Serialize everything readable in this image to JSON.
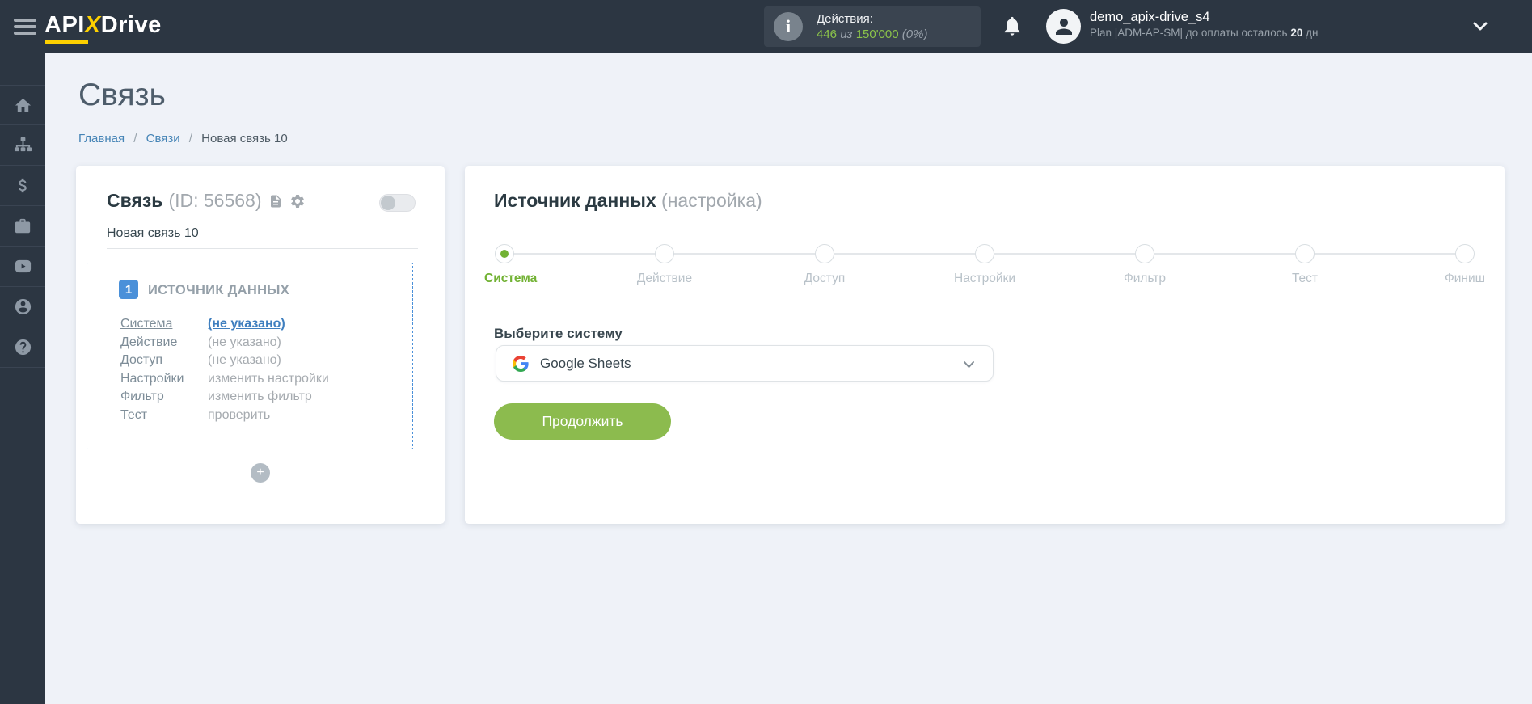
{
  "colors": {
    "navbar_bg": "#2c3642",
    "brand_yellow": "#fdd000",
    "accent_green": "#72b234",
    "button_green": "#8cbb4e",
    "link_blue": "#4584b6",
    "badge_blue": "#4a90d9",
    "page_bg": "#eff2f8"
  },
  "topbar": {
    "logo": {
      "api": "API",
      "x": "X",
      "drive": "Drive"
    },
    "actions": {
      "info_glyph": "i",
      "label": "Действия:",
      "used": "446",
      "of_word": "из",
      "total": "150'000",
      "percent": "(0%)"
    },
    "user": {
      "name": "demo_apix-drive_s4",
      "plan_prefix": "Plan |ADM-AP-SM| до оплаты осталось",
      "days_left": "20",
      "days_suffix": "дн"
    }
  },
  "sidebar": {
    "icons": [
      "home",
      "sitemap",
      "dollar",
      "briefcase",
      "video",
      "user",
      "help"
    ]
  },
  "page": {
    "title": "Связь",
    "breadcrumb": {
      "home": "Главная",
      "links": "Связи",
      "current": "Новая связь 10"
    },
    "breadcrumb_separator": "/"
  },
  "connection_card": {
    "title": "Связь",
    "id_text": "(ID: 56568)",
    "name": "Новая связь 10",
    "source_block": {
      "badge": "1",
      "title": "ИСТОЧНИК ДАННЫХ",
      "rows": [
        {
          "label": "Система",
          "value": "(не указано)"
        },
        {
          "label": "Действие",
          "value": "(не указано)"
        },
        {
          "label": "Доступ",
          "value": "(не указано)"
        },
        {
          "label": "Настройки",
          "value": "изменить настройки"
        },
        {
          "label": "Фильтр",
          "value": "изменить фильтр"
        },
        {
          "label": "Тест",
          "value": "проверить"
        }
      ]
    },
    "add_label": "+"
  },
  "source_card": {
    "title": "Источник данных",
    "subtitle": "(настройка)",
    "steps": [
      {
        "label": "Система",
        "active": true
      },
      {
        "label": "Действие"
      },
      {
        "label": "Доступ"
      },
      {
        "label": "Настройки"
      },
      {
        "label": "Фильтр"
      },
      {
        "label": "Тест"
      },
      {
        "label": "Финиш"
      }
    ],
    "select_label": "Выберите систему",
    "selected_system": "Google Sheets",
    "continue_label": "Продолжить"
  }
}
